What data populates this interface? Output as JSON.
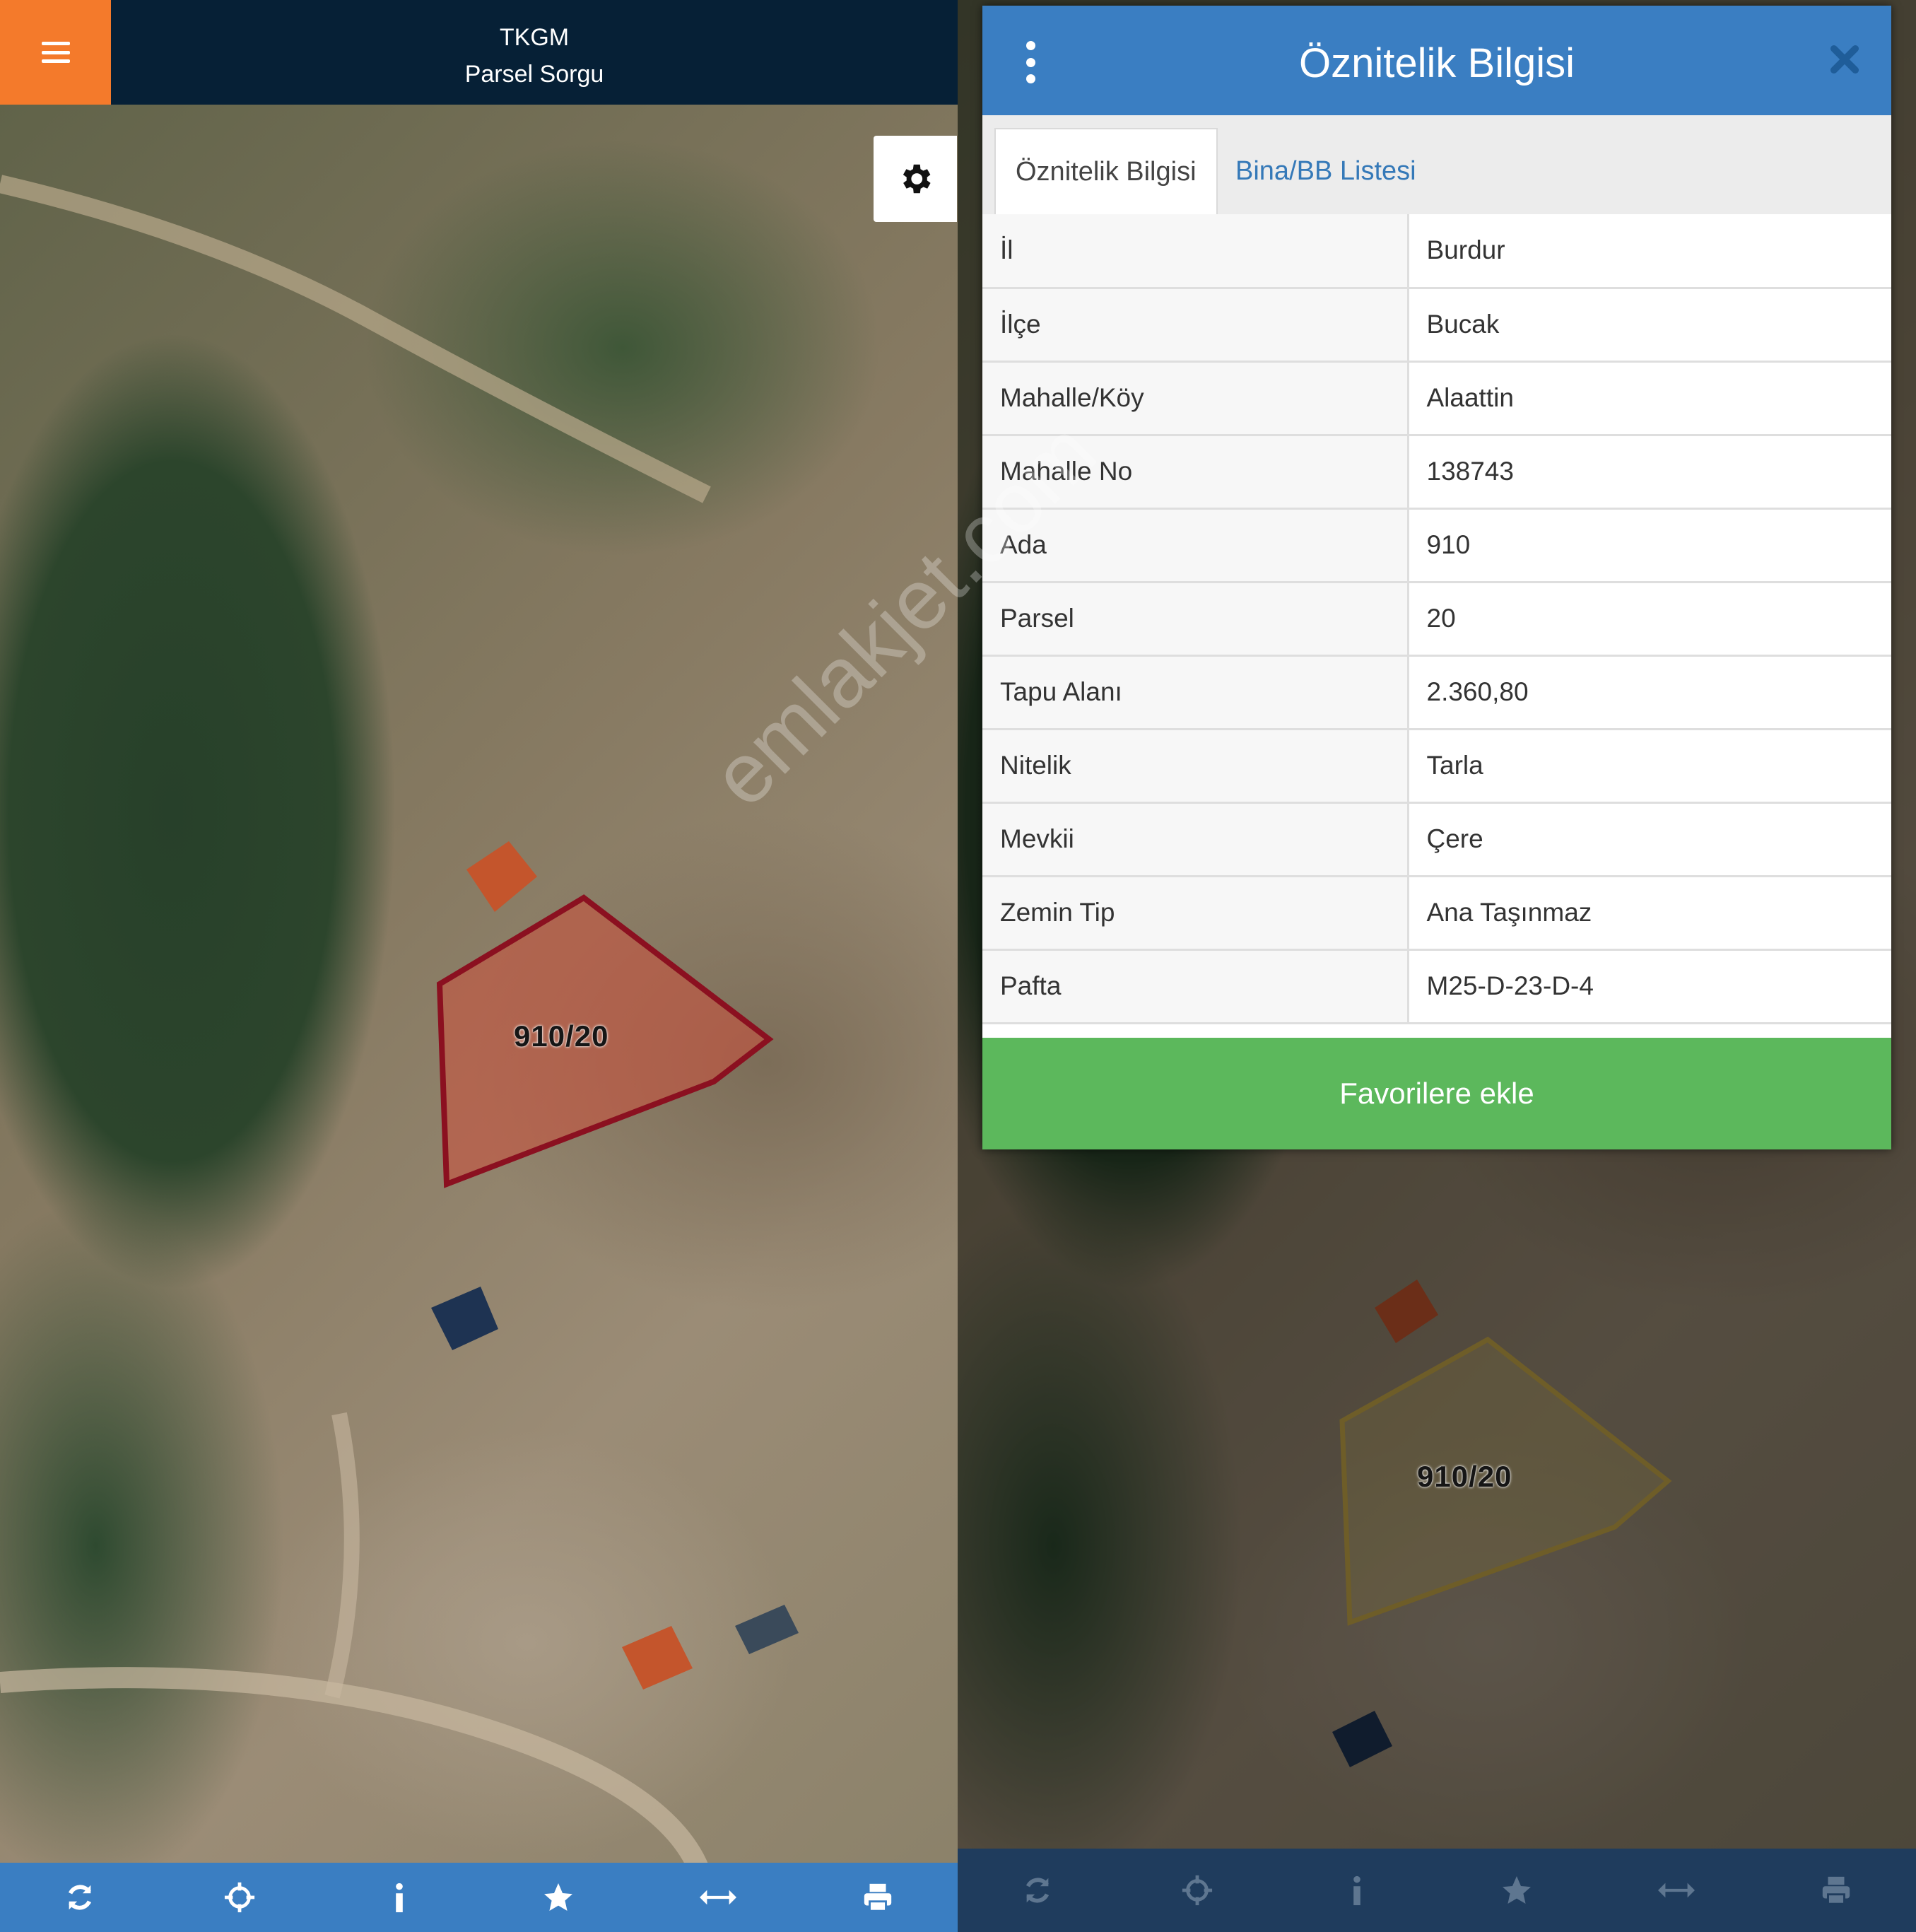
{
  "header": {
    "app_name": "TKGM",
    "subtitle": "Parsel Sorgu"
  },
  "parcel_label": "910/20",
  "dialog": {
    "title": "Öznitelik Bilgisi",
    "tabs": [
      {
        "label": "Öznitelik Bilgisi",
        "active": true
      },
      {
        "label": "Bina/BB Listesi",
        "active": false
      }
    ],
    "rows": [
      {
        "key": "İl",
        "value": "Burdur"
      },
      {
        "key": "İlçe",
        "value": "Bucak"
      },
      {
        "key": "Mahalle/Köy",
        "value": "Alaattin"
      },
      {
        "key": "Mahalle No",
        "value": "138743"
      },
      {
        "key": "Ada",
        "value": "910"
      },
      {
        "key": "Parsel",
        "value": "20"
      },
      {
        "key": "Tapu Alanı",
        "value": "2.360,80"
      },
      {
        "key": "Nitelik",
        "value": "Tarla"
      },
      {
        "key": "Mevkii",
        "value": "Çere"
      },
      {
        "key": "Zemin Tip",
        "value": "Ana Taşınmaz"
      },
      {
        "key": "Pafta",
        "value": "M25-D-23-D-4"
      }
    ],
    "favorite_button": "Favorilere ekle"
  },
  "watermark": "emlakjet.com",
  "toolbar_icons": [
    "refresh-icon",
    "locate-icon",
    "info-icon",
    "star-icon",
    "measure-icon",
    "print-icon"
  ],
  "colors": {
    "header_bg": "#062036",
    "hamburger_bg": "#f47a2b",
    "accent_blue": "#3a7ec2",
    "favorite_green": "#5cb85c",
    "parcel_outline_selected": "#8b1020",
    "parcel_outline_default": "#c9a94a"
  }
}
